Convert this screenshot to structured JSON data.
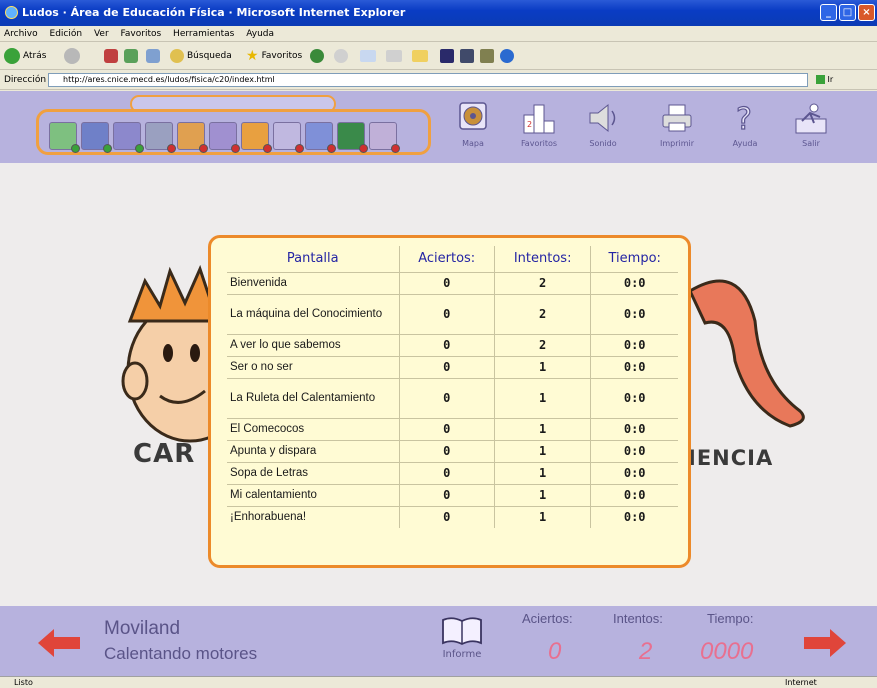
{
  "window": {
    "title": "Ludos · Área de Educación Física · Microsoft Internet Explorer"
  },
  "menu": [
    "Archivo",
    "Edición",
    "Ver",
    "Favoritos",
    "Herramientas",
    "Ayuda"
  ],
  "browser_toolbar": {
    "back_label": "Atrás",
    "search_label": "Búsqueda",
    "favorites_label": "Favoritos"
  },
  "address": {
    "label": "Dirección",
    "url": "http://ares.cnice.mecd.es/ludos/fisica/c20/index.html",
    "go_label": "Ir"
  },
  "nav": {
    "mapa": "Mapa",
    "favoritos": "Favoritos",
    "sonido": "Sonido",
    "imprimir": "Imprimir",
    "ayuda": "Ayuda",
    "salir": "Salir"
  },
  "background_text": {
    "left": "CAR",
    "right": "IENCIA"
  },
  "score_table": {
    "headers": [
      "Pantalla",
      "Aciertos:",
      "Intentos:",
      "Tiempo:"
    ],
    "rows": [
      {
        "name": "Bienvenida",
        "aciertos": "0",
        "intentos": "2",
        "tiempo": "0:0"
      },
      {
        "name": "La máquina del Conocimiento",
        "aciertos": "0",
        "intentos": "2",
        "tiempo": "0:0"
      },
      {
        "name": "A ver lo que sabemos",
        "aciertos": "0",
        "intentos": "2",
        "tiempo": "0:0"
      },
      {
        "name": "Ser o no ser",
        "aciertos": "0",
        "intentos": "1",
        "tiempo": "0:0"
      },
      {
        "name": "La Ruleta del Calentamiento",
        "aciertos": "0",
        "intentos": "1",
        "tiempo": "0:0"
      },
      {
        "name": "El Comecocos",
        "aciertos": "0",
        "intentos": "1",
        "tiempo": "0:0"
      },
      {
        "name": "Apunta y dispara",
        "aciertos": "0",
        "intentos": "1",
        "tiempo": "0:0"
      },
      {
        "name": "Sopa de Letras",
        "aciertos": "0",
        "intentos": "1",
        "tiempo": "0:0"
      },
      {
        "name": "Mi calentamiento",
        "aciertos": "0",
        "intentos": "1",
        "tiempo": "0:0"
      },
      {
        "name": "¡Enhorabuena!",
        "aciertos": "0",
        "intentos": "1",
        "tiempo": "0:0"
      }
    ]
  },
  "bottom": {
    "title": "Moviland",
    "subtitle": "Calentando motores",
    "informe": "Informe",
    "aciertos_label": "Aciertos:",
    "intentos_label": "Intentos:",
    "tiempo_label": "Tiempo:",
    "aciertos_value": "0",
    "intentos_value": "2",
    "tiempo_value": "0000"
  },
  "status": {
    "left": "Listo",
    "zone": "Internet"
  },
  "colors": {
    "band": "#b7b2de",
    "accent": "#ec8a2a",
    "table_bg": "#fffbd4",
    "header_text": "#2424a4",
    "score_pink": "#e87090",
    "arrow_red": "#e0453a"
  }
}
